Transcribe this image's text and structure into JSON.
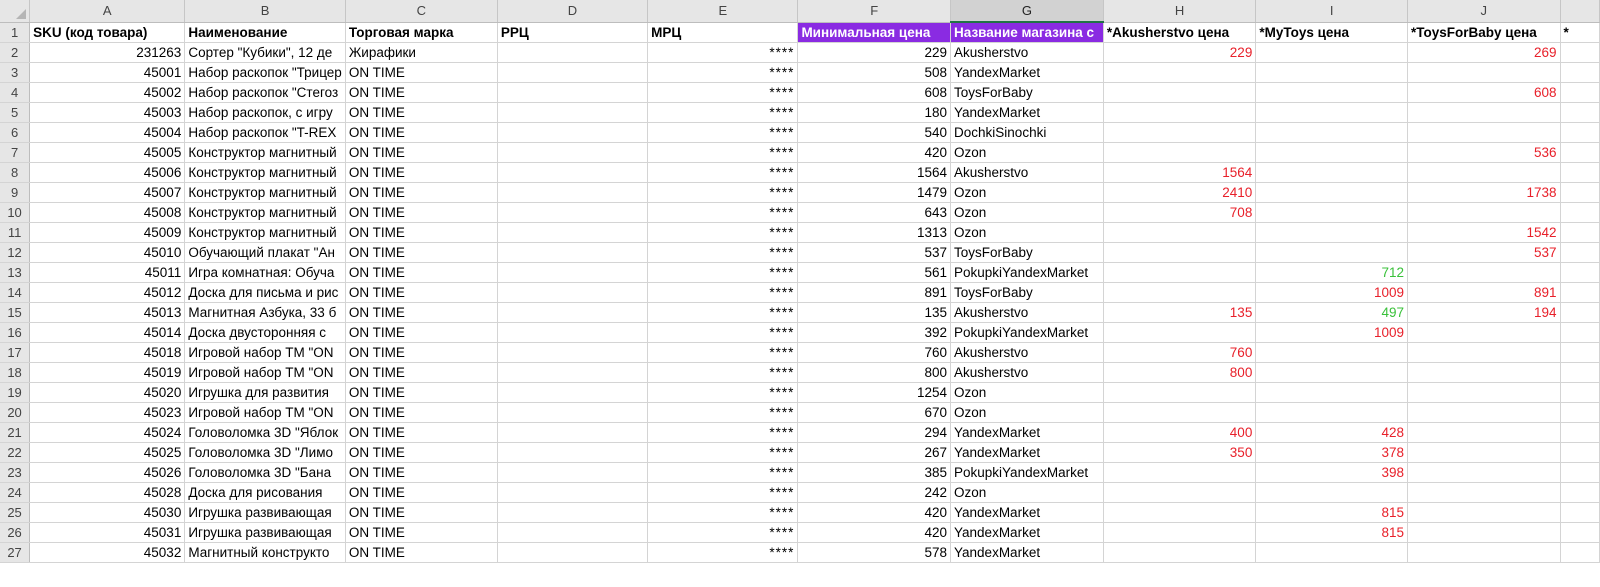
{
  "colors": {
    "purple_header": "#8a2be2",
    "red_price": "#e8202a",
    "green_price": "#39c13a"
  },
  "columns": [
    "A",
    "B",
    "C",
    "D",
    "E",
    "F",
    "G",
    "H",
    "I",
    "J",
    ""
  ],
  "selected_column": "G",
  "headers": {
    "sku": "SKU (код товара)",
    "name": "Наименование",
    "brand": "Торговая марка",
    "rrc": "РРЦ",
    "mrc": "МРЦ",
    "min_price": "Минимальная цена",
    "store_name": "Название магазина с",
    "akusherstvo": "*Akusherstvo цена",
    "mytoys": "*MyToys цена",
    "toysforbaby": "*ToysForBaby цена",
    "extra": "*"
  },
  "rows": [
    {
      "n": "2",
      "sku": "231263",
      "name": "Сортер \"Кубики\", 12 де",
      "brand": "Жирафики",
      "rrc": "",
      "mrc": "****",
      "min": "229",
      "store": "Akusherstvo",
      "h": "229",
      "hc": "red",
      "i": "",
      "ic": "",
      "j": "269",
      "jc": "red"
    },
    {
      "n": "3",
      "sku": "45001",
      "name": "Набор раскопок \"Трицер",
      "brand": "ON TIME",
      "rrc": "",
      "mrc": "****",
      "min": "508",
      "store": "YandexMarket",
      "h": "",
      "hc": "",
      "i": "",
      "ic": "",
      "j": "",
      "jc": ""
    },
    {
      "n": "4",
      "sku": "45002",
      "name": "Набор раскопок \"Стегоз",
      "brand": "ON TIME",
      "rrc": "",
      "mrc": "****",
      "min": "608",
      "store": "ToysForBaby",
      "h": "",
      "hc": "",
      "i": "",
      "ic": "",
      "j": "608",
      "jc": "red"
    },
    {
      "n": "5",
      "sku": "45003",
      "name": "Набор раскопок, с игру",
      "brand": "ON TIME",
      "rrc": "",
      "mrc": "****",
      "min": "180",
      "store": "YandexMarket",
      "h": "",
      "hc": "",
      "i": "",
      "ic": "",
      "j": "",
      "jc": ""
    },
    {
      "n": "6",
      "sku": "45004",
      "name": "Набор раскопок \"T-REX",
      "brand": "ON TIME",
      "rrc": "",
      "mrc": "****",
      "min": "540",
      "store": "DochkiSinochki",
      "h": "",
      "hc": "",
      "i": "",
      "ic": "",
      "j": "",
      "jc": ""
    },
    {
      "n": "7",
      "sku": "45005",
      "name": "Конструктор магнитный",
      "brand": "ON TIME",
      "rrc": "",
      "mrc": "****",
      "min": "420",
      "store": "Ozon",
      "h": "",
      "hc": "",
      "i": "",
      "ic": "",
      "j": "536",
      "jc": "red"
    },
    {
      "n": "8",
      "sku": "45006",
      "name": "Конструктор магнитный",
      "brand": "ON TIME",
      "rrc": "",
      "mrc": "****",
      "min": "1564",
      "store": "Akusherstvo",
      "h": "1564",
      "hc": "red",
      "i": "",
      "ic": "",
      "j": "",
      "jc": ""
    },
    {
      "n": "9",
      "sku": "45007",
      "name": "Конструктор магнитный",
      "brand": "ON TIME",
      "rrc": "",
      "mrc": "****",
      "min": "1479",
      "store": "Ozon",
      "h": "2410",
      "hc": "red",
      "i": "",
      "ic": "",
      "j": "1738",
      "jc": "red"
    },
    {
      "n": "10",
      "sku": "45008",
      "name": "Конструктор магнитный",
      "brand": "ON TIME",
      "rrc": "",
      "mrc": "****",
      "min": "643",
      "store": "Ozon",
      "h": "708",
      "hc": "red",
      "i": "",
      "ic": "",
      "j": "",
      "jc": ""
    },
    {
      "n": "11",
      "sku": "45009",
      "name": "Конструктор магнитный",
      "brand": "ON TIME",
      "rrc": "",
      "mrc": "****",
      "min": "1313",
      "store": "Ozon",
      "h": "",
      "hc": "",
      "i": "",
      "ic": "",
      "j": "1542",
      "jc": "red"
    },
    {
      "n": "12",
      "sku": "45010",
      "name": "Обучающий плакат \"Ан",
      "brand": "ON TIME",
      "rrc": "",
      "mrc": "****",
      "min": "537",
      "store": "ToysForBaby",
      "h": "",
      "hc": "",
      "i": "",
      "ic": "",
      "j": "537",
      "jc": "red"
    },
    {
      "n": "13",
      "sku": "45011",
      "name": "Игра комнатная: Обуча",
      "brand": "ON TIME",
      "rrc": "",
      "mrc": "****",
      "min": "561",
      "store": "PokupkiYandexMarket",
      "h": "",
      "hc": "",
      "i": "712",
      "ic": "green",
      "j": "",
      "jc": ""
    },
    {
      "n": "14",
      "sku": "45012",
      "name": "Доска для письма и рис",
      "brand": "ON TIME",
      "rrc": "",
      "mrc": "****",
      "min": "891",
      "store": "ToysForBaby",
      "h": "",
      "hc": "",
      "i": "1009",
      "ic": "red",
      "j": "891",
      "jc": "red"
    },
    {
      "n": "15",
      "sku": "45013",
      "name": "Магнитная Азбука, 33 б",
      "brand": "ON TIME",
      "rrc": "",
      "mrc": "****",
      "min": "135",
      "store": "Akusherstvo",
      "h": "135",
      "hc": "red",
      "i": "497",
      "ic": "green",
      "j": "194",
      "jc": "red"
    },
    {
      "n": "16",
      "sku": "45014",
      "name": "Доска двусторонняя с",
      "brand": "ON TIME",
      "rrc": "",
      "mrc": "****",
      "min": "392",
      "store": "PokupkiYandexMarket",
      "h": "",
      "hc": "",
      "i": "1009",
      "ic": "red",
      "j": "",
      "jc": ""
    },
    {
      "n": "17",
      "sku": "45018",
      "name": "Игровой набор ТМ \"ON",
      "brand": "ON TIME",
      "rrc": "",
      "mrc": "****",
      "min": "760",
      "store": "Akusherstvo",
      "h": "760",
      "hc": "red",
      "i": "",
      "ic": "",
      "j": "",
      "jc": ""
    },
    {
      "n": "18",
      "sku": "45019",
      "name": "Игровой набор ТМ \"ON",
      "brand": "ON TIME",
      "rrc": "",
      "mrc": "****",
      "min": "800",
      "store": "Akusherstvo",
      "h": "800",
      "hc": "red",
      "i": "",
      "ic": "",
      "j": "",
      "jc": ""
    },
    {
      "n": "19",
      "sku": "45020",
      "name": "Игрушка для развития",
      "brand": "ON TIME",
      "rrc": "",
      "mrc": "****",
      "min": "1254",
      "store": "Ozon",
      "h": "",
      "hc": "",
      "i": "",
      "ic": "",
      "j": "",
      "jc": ""
    },
    {
      "n": "20",
      "sku": "45023",
      "name": "Игровой набор ТМ \"ON",
      "brand": "ON TIME",
      "rrc": "",
      "mrc": "****",
      "min": "670",
      "store": "Ozon",
      "h": "",
      "hc": "",
      "i": "",
      "ic": "",
      "j": "",
      "jc": ""
    },
    {
      "n": "21",
      "sku": "45024",
      "name": "Головоломка 3D \"Яблок",
      "brand": "ON TIME",
      "rrc": "",
      "mrc": "****",
      "min": "294",
      "store": "YandexMarket",
      "h": "400",
      "hc": "red",
      "i": "428",
      "ic": "red",
      "j": "",
      "jc": ""
    },
    {
      "n": "22",
      "sku": "45025",
      "name": "Головоломка 3D \"Лимо",
      "brand": "ON TIME",
      "rrc": "",
      "mrc": "****",
      "min": "267",
      "store": "YandexMarket",
      "h": "350",
      "hc": "red",
      "i": "378",
      "ic": "red",
      "j": "",
      "jc": ""
    },
    {
      "n": "23",
      "sku": "45026",
      "name": "Головоломка 3D \"Бана",
      "brand": "ON TIME",
      "rrc": "",
      "mrc": "****",
      "min": "385",
      "store": "PokupkiYandexMarket",
      "h": "",
      "hc": "",
      "i": "398",
      "ic": "red",
      "j": "",
      "jc": ""
    },
    {
      "n": "24",
      "sku": "45028",
      "name": "Доска для рисования",
      "brand": "ON TIME",
      "rrc": "",
      "mrc": "****",
      "min": "242",
      "store": "Ozon",
      "h": "",
      "hc": "",
      "i": "",
      "ic": "",
      "j": "",
      "jc": ""
    },
    {
      "n": "25",
      "sku": "45030",
      "name": "Игрушка развивающая",
      "brand": "ON TIME",
      "rrc": "",
      "mrc": "****",
      "min": "420",
      "store": "YandexMarket",
      "h": "",
      "hc": "",
      "i": "815",
      "ic": "red",
      "j": "",
      "jc": ""
    },
    {
      "n": "26",
      "sku": "45031",
      "name": "Игрушка развивающая",
      "brand": "ON TIME",
      "rrc": "",
      "mrc": "****",
      "min": "420",
      "store": "YandexMarket",
      "h": "",
      "hc": "",
      "i": "815",
      "ic": "red",
      "j": "",
      "jc": ""
    },
    {
      "n": "27",
      "sku": "45032",
      "name": "Магнитный конструкто",
      "brand": "ON TIME",
      "rrc": "",
      "mrc": "****",
      "min": "578",
      "store": "YandexMarket",
      "h": "",
      "hc": "",
      "i": "",
      "ic": "",
      "j": "",
      "jc": ""
    }
  ]
}
